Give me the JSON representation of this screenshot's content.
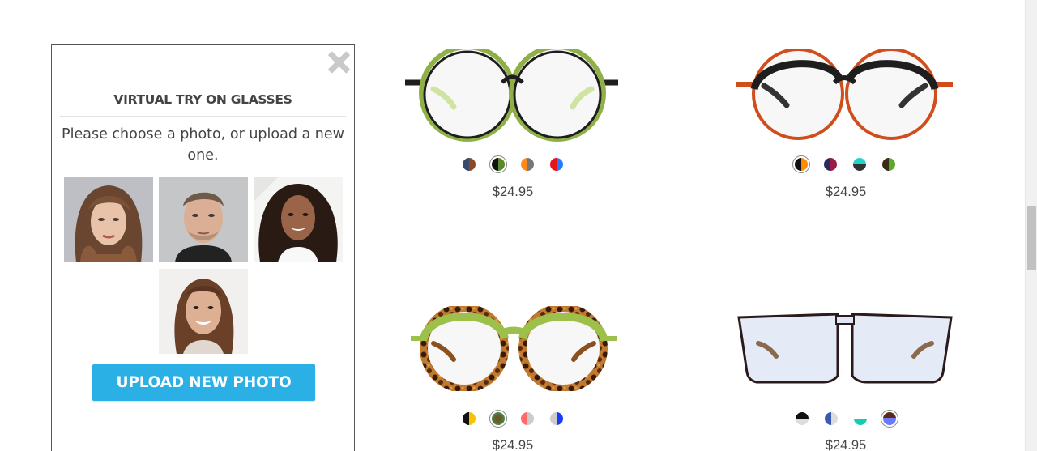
{
  "try_on_panel": {
    "title": "VIRTUAL TRY ON GLASSES",
    "instructions": "Please choose a photo, or upload a new one.",
    "upload_button_label": "UPLOAD NEW PHOTO",
    "close_icon": "close-icon",
    "sample_photos": [
      {
        "name": "woman-wavy-hair"
      },
      {
        "name": "man-stubble"
      },
      {
        "name": "woman-curly-hair"
      },
      {
        "name": "woman-smiling"
      }
    ]
  },
  "products": [
    {
      "price": "$24.95",
      "frame_colors": {
        "rim": "#1e1e1e",
        "accent": "#8fb046",
        "temple": "#cfe4a0"
      },
      "swatches": [
        {
          "left": "#3a4a6a",
          "right": "#8a4a2a",
          "selected": false
        },
        {
          "left": "#111111",
          "right": "#5a8a2a",
          "selected": true
        },
        {
          "left": "#ff8a1a",
          "right": "#777777",
          "selected": false
        },
        {
          "left": "#e8141a",
          "right": "#2a7aff",
          "selected": false
        }
      ]
    },
    {
      "price": "$24.95",
      "frame_colors": {
        "rim": "#d04e1b",
        "accent": "#1e1e1e",
        "temple": "#333333"
      },
      "swatches": [
        {
          "left": "#111111",
          "right": "#ff8a00",
          "selected": true
        },
        {
          "left": "#2a2a5a",
          "right": "#9a1a4a",
          "selected": false
        },
        {
          "left": "#1fd6c8",
          "right": "#333333",
          "selected": false
        },
        {
          "left": "#3a2a1a",
          "right": "#5aaa2a",
          "selected": false
        }
      ]
    },
    {
      "price": "$24.95",
      "frame_colors": {
        "rim": "#6b3a16",
        "accent": "#9cc04a",
        "temple": "#8a5020"
      },
      "swatches": [
        {
          "left": "#111111",
          "right": "#f5c400",
          "selected": false
        },
        {
          "left": "#6a5a2a",
          "right": "#4a8a4a",
          "selected": true
        },
        {
          "left": "#ff6a6a",
          "right": "#cccccc",
          "selected": false
        },
        {
          "left": "#cccccc",
          "right": "#1a3aff",
          "selected": false
        }
      ]
    },
    {
      "price": "$24.95",
      "frame_colors": {
        "rim": "#2a1a1a",
        "accent": "#dfe7f5",
        "temple": "#8a6a4a"
      },
      "swatches": [
        {
          "left": "#ffffff",
          "right": "#111111",
          "selected": false
        },
        {
          "left": "#3a5ab0",
          "right": "#dddddd",
          "selected": false
        },
        {
          "left": "#ffffff",
          "right": "#12cfae",
          "selected": false
        },
        {
          "left": "#5a2a1a",
          "right": "#6a7aff",
          "selected": true
        }
      ]
    }
  ]
}
